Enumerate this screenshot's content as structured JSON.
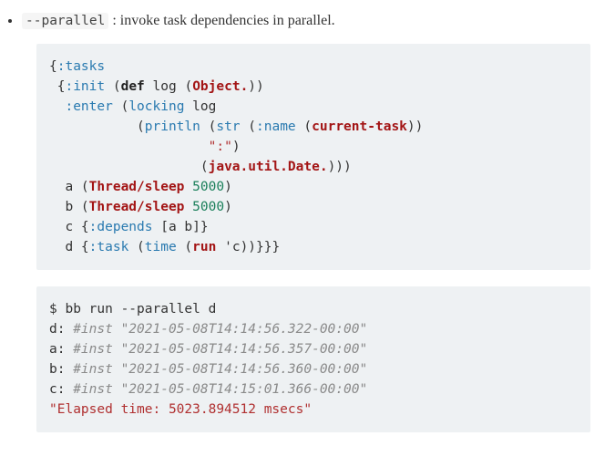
{
  "bullet": {
    "flag": "--parallel",
    "desc": " : invoke task dependencies in parallel."
  },
  "code1": {
    "l1_a": "{",
    "l1_key": ":tasks",
    "l2_a": " {",
    "l2_key": ":init",
    "l2_b": " (",
    "l2_def": "def",
    "l2_c": " log (",
    "l2_obj": "Object.",
    "l2_d": "))",
    "l3_a": "  ",
    "l3_key": ":enter",
    "l3_b": " (",
    "l3_lock": "locking",
    "l3_c": " log",
    "l4_a": "           (",
    "l4_pr": "println",
    "l4_b": " (",
    "l4_str": "str",
    "l4_c": " (",
    "l4_name": ":name",
    "l4_d": " (",
    "l4_ct": "current-task",
    "l4_e": "))",
    "l5_a": "                    ",
    "l5_str": "\":\"",
    "l5_b": ")",
    "l6_a": "                   (",
    "l6_date": "java.util.Date.",
    "l6_b": ")))",
    "l7_a": "  a (",
    "l7_ts": "Thread/sleep",
    "l7_sp": " ",
    "l7_num": "5000",
    "l7_b": ")",
    "l8_a": "  b (",
    "l8_ts": "Thread/sleep",
    "l8_sp": " ",
    "l8_num": "5000",
    "l8_b": ")",
    "l9_a": "  c {",
    "l9_key": ":depends",
    "l9_b": " [a b]}",
    "l10_a": "  d {",
    "l10_key": ":task",
    "l10_b": " (",
    "l10_time": "time",
    "l10_c": " (",
    "l10_run": "run",
    "l10_d": " 'c))}}}"
  },
  "code2": {
    "prompt": "$ bb run --parallel d",
    "d_lbl": "d: ",
    "d_cmt": "#inst \"2021-05-08T14:14:56.322-00:00\"",
    "a_lbl": "a: ",
    "a_cmt": "#inst \"2021-05-08T14:14:56.357-00:00\"",
    "b_lbl": "b: ",
    "b_cmt": "#inst \"2021-05-08T14:14:56.360-00:00\"",
    "c_lbl": "c: ",
    "c_cmt": "#inst \"2021-05-08T14:15:01.366-00:00\"",
    "elapsed": "\"Elapsed time: 5023.894512 msecs\""
  }
}
